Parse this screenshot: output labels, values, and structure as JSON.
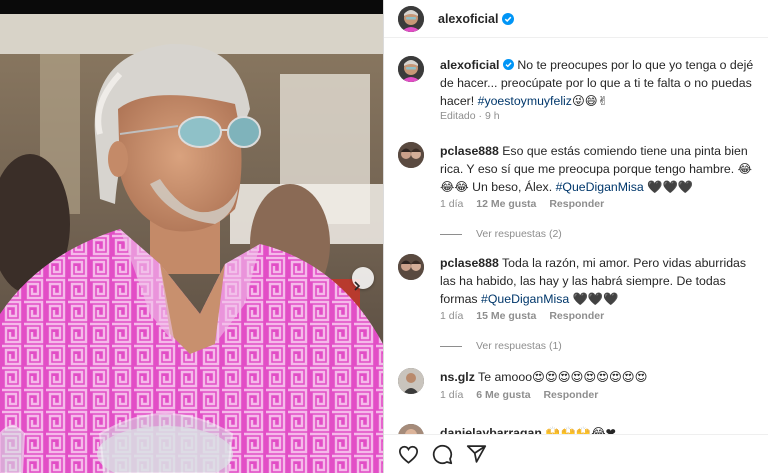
{
  "post": {
    "username": "alexoficial",
    "caption": "No te preocupes por lo que yo tenga o dejé de hacer... preocúpate por lo que a ti te falta o no puedas hacer!",
    "hashtag": "#yoestoymuyfeliz",
    "caption_emojis": "😜😄✌",
    "edited": "Editado · 9 h"
  },
  "comments": [
    {
      "username": "pclase888",
      "text": "Eso que estás comiendo tiene una pinta bien rica. Y eso sí que me preocupa porque tengo hambre. 😂😂😂 Un beso, Álex.",
      "hashtag": "#QueDiganMisa",
      "suffix": "🖤🖤🖤",
      "time": "1 día",
      "likes": "12 Me gusta",
      "reply": "Responder",
      "view_replies": "Ver respuestas (2)"
    },
    {
      "username": "pclase888",
      "text": "Toda la razón, mi amor. Pero vidas aburridas las ha habido, las hay y las habrá siempre. De todas formas",
      "hashtag": "#QueDiganMisa",
      "suffix": "🖤🖤🖤",
      "time": "1 día",
      "likes": "15 Me gusta",
      "reply": "Responder",
      "view_replies": "Ver respuestas (1)"
    },
    {
      "username": "ns.glz",
      "text": "Te amooo😍😍😍😍😍😍😍😍😍",
      "time": "1 día",
      "likes": "6 Me gusta",
      "reply": "Responder"
    },
    {
      "username": "danielaybarragan",
      "text": "🙌🙌🙌😂❤"
    }
  ],
  "icons": [
    "heart-icon",
    "comment-icon",
    "share-icon",
    "verified-badge-icon",
    "chevron-right-icon"
  ],
  "colors": {
    "hashtag": "#00376b",
    "verified": "#0095f6",
    "muted": "#8e8e8e",
    "shirt_pink": "#e64fc9"
  }
}
